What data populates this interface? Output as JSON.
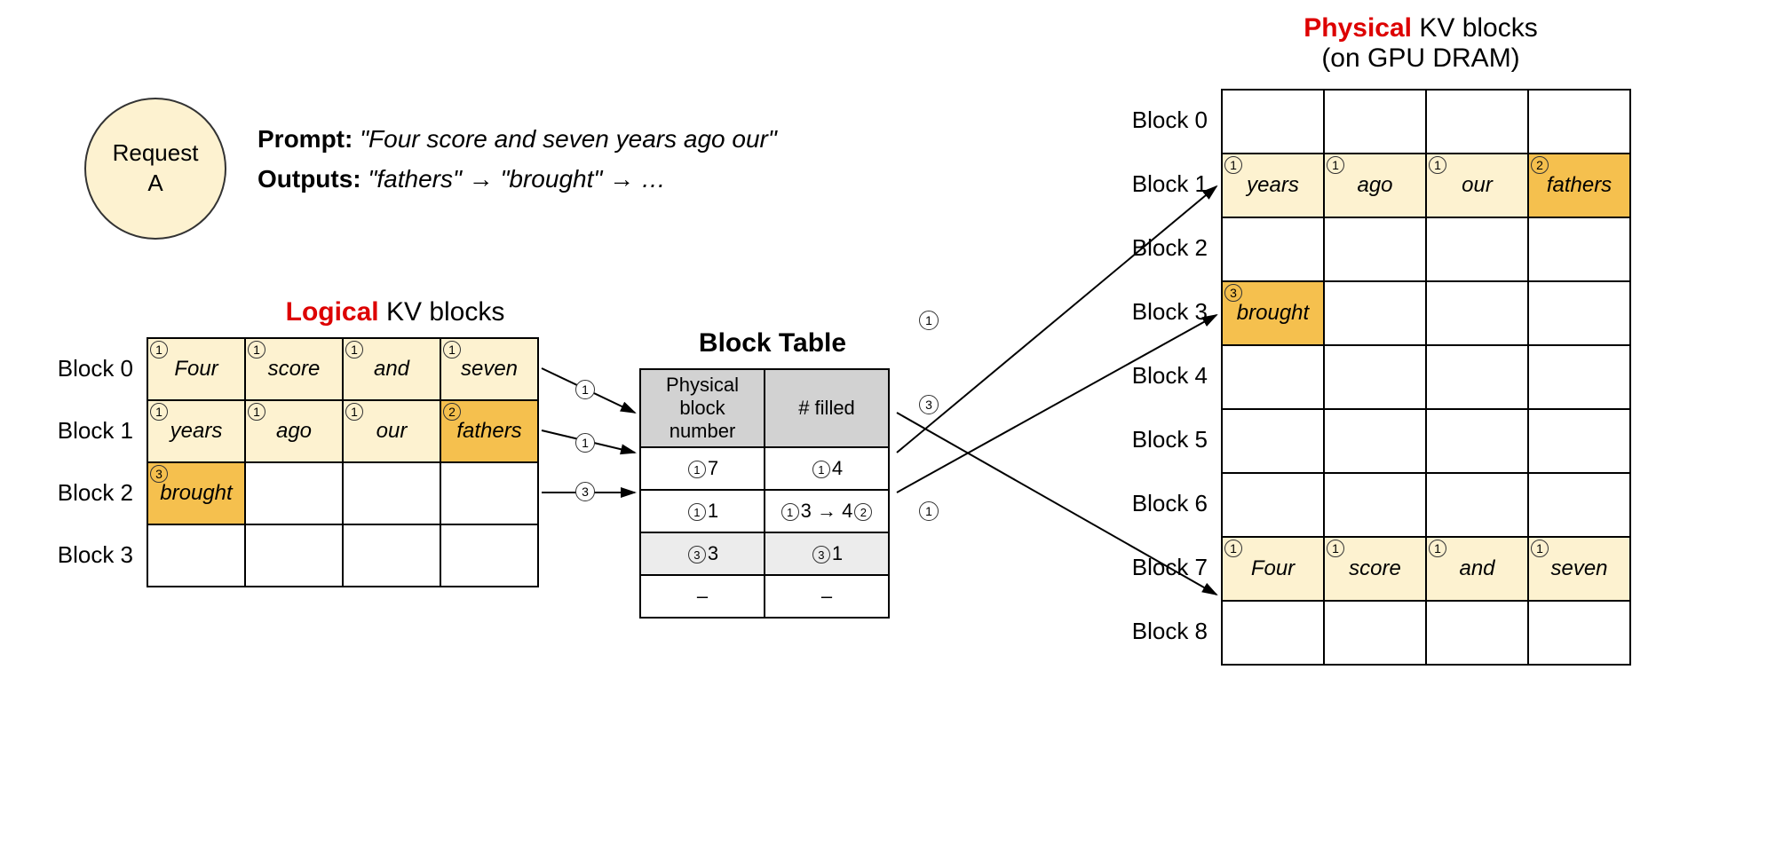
{
  "request": {
    "name": "Request\nA"
  },
  "prompt": {
    "label": "Prompt:",
    "text": "\"Four score and seven years ago our\"",
    "outputs_label": "Outputs:",
    "outputs_text": "\"fathers\" → \"brought\" → …"
  },
  "logical": {
    "title_red": "Logical",
    "title_rest": " KV blocks",
    "row_labels": [
      "Block 0",
      "Block 1",
      "Block 2",
      "Block 3"
    ],
    "cells": [
      [
        {
          "t": "Four",
          "b": "1",
          "c": "light"
        },
        {
          "t": "score",
          "b": "1",
          "c": "light"
        },
        {
          "t": "and",
          "b": "1",
          "c": "light"
        },
        {
          "t": "seven",
          "b": "1",
          "c": "light"
        }
      ],
      [
        {
          "t": "years",
          "b": "1",
          "c": "light"
        },
        {
          "t": "ago",
          "b": "1",
          "c": "light"
        },
        {
          "t": "our",
          "b": "1",
          "c": "light"
        },
        {
          "t": "fathers",
          "b": "2",
          "c": "dark"
        }
      ],
      [
        {
          "t": "brought",
          "b": "3",
          "c": "dark"
        },
        {
          "t": "",
          "b": "",
          "c": ""
        },
        {
          "t": "",
          "b": "",
          "c": ""
        },
        {
          "t": "",
          "b": "",
          "c": ""
        }
      ],
      [
        {
          "t": "",
          "b": "",
          "c": ""
        },
        {
          "t": "",
          "b": "",
          "c": ""
        },
        {
          "t": "",
          "b": "",
          "c": ""
        },
        {
          "t": "",
          "b": "",
          "c": ""
        }
      ]
    ]
  },
  "block_table": {
    "title": "Block Table",
    "headers": [
      "Physical block\nnumber",
      "# filled"
    ],
    "rows": [
      {
        "pb_badge": "1",
        "pb": "7",
        "f_badge": "1",
        "f": "4",
        "shade": false
      },
      {
        "pb_badge": "1",
        "pb": "1",
        "f_badge": "1",
        "f": "3 → 4",
        "f_badge2": "2",
        "shade": false
      },
      {
        "pb_badge": "3",
        "pb": "3",
        "f_badge": "3",
        "f": "1",
        "shade": true
      },
      {
        "pb_badge": "",
        "pb": "–",
        "f_badge": "",
        "f": "–",
        "shade": false
      }
    ]
  },
  "physical": {
    "title_red": "Physical",
    "title_rest": " KV blocks",
    "subtitle": "(on GPU DRAM)",
    "row_labels": [
      "Block 0",
      "Block 1",
      "Block 2",
      "Block 3",
      "Block 4",
      "Block 5",
      "Block 6",
      "Block 7",
      "Block 8"
    ],
    "cells": [
      [
        {
          "t": "",
          "b": "",
          "c": ""
        },
        {
          "t": "",
          "b": "",
          "c": ""
        },
        {
          "t": "",
          "b": "",
          "c": ""
        },
        {
          "t": "",
          "b": "",
          "c": ""
        }
      ],
      [
        {
          "t": "years",
          "b": "1",
          "c": "light"
        },
        {
          "t": "ago",
          "b": "1",
          "c": "light"
        },
        {
          "t": "our",
          "b": "1",
          "c": "light"
        },
        {
          "t": "fathers",
          "b": "2",
          "c": "dark"
        }
      ],
      [
        {
          "t": "",
          "b": "",
          "c": ""
        },
        {
          "t": "",
          "b": "",
          "c": ""
        },
        {
          "t": "",
          "b": "",
          "c": ""
        },
        {
          "t": "",
          "b": "",
          "c": ""
        }
      ],
      [
        {
          "t": "brought",
          "b": "3",
          "c": "dark"
        },
        {
          "t": "",
          "b": "",
          "c": ""
        },
        {
          "t": "",
          "b": "",
          "c": ""
        },
        {
          "t": "",
          "b": "",
          "c": ""
        }
      ],
      [
        {
          "t": "",
          "b": "",
          "c": ""
        },
        {
          "t": "",
          "b": "",
          "c": ""
        },
        {
          "t": "",
          "b": "",
          "c": ""
        },
        {
          "t": "",
          "b": "",
          "c": ""
        }
      ],
      [
        {
          "t": "",
          "b": "",
          "c": ""
        },
        {
          "t": "",
          "b": "",
          "c": ""
        },
        {
          "t": "",
          "b": "",
          "c": ""
        },
        {
          "t": "",
          "b": "",
          "c": ""
        }
      ],
      [
        {
          "t": "",
          "b": "",
          "c": ""
        },
        {
          "t": "",
          "b": "",
          "c": ""
        },
        {
          "t": "",
          "b": "",
          "c": ""
        },
        {
          "t": "",
          "b": "",
          "c": ""
        }
      ],
      [
        {
          "t": "Four",
          "b": "1",
          "c": "light"
        },
        {
          "t": "score",
          "b": "1",
          "c": "light"
        },
        {
          "t": "and",
          "b": "1",
          "c": "light"
        },
        {
          "t": "seven",
          "b": "1",
          "c": "light"
        }
      ],
      [
        {
          "t": "",
          "b": "",
          "c": ""
        },
        {
          "t": "",
          "b": "",
          "c": ""
        },
        {
          "t": "",
          "b": "",
          "c": ""
        },
        {
          "t": "",
          "b": "",
          "c": ""
        }
      ]
    ]
  },
  "arrow_badges": {
    "l0": "1",
    "l1": "1",
    "l2": "3",
    "r0": "1",
    "r1": "3",
    "r2": "1"
  }
}
